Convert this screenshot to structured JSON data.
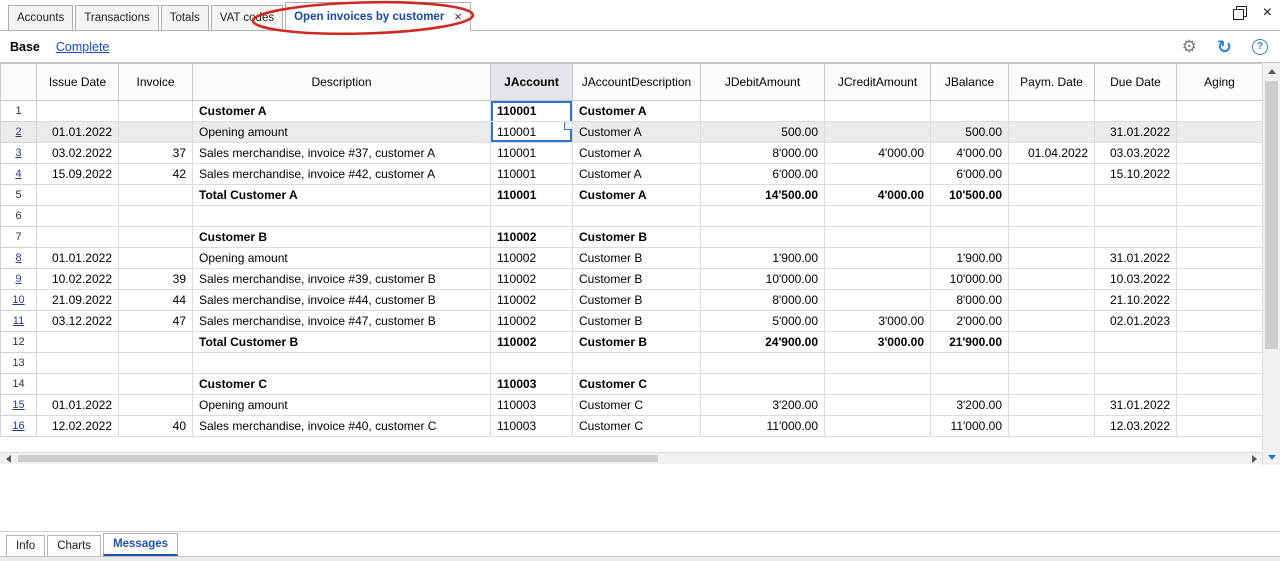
{
  "icons": {
    "close": "×",
    "gear": "⚙",
    "refresh": "↻",
    "help": "?"
  },
  "window": {
    "tabs": [
      {
        "label": "Accounts"
      },
      {
        "label": "Transactions"
      },
      {
        "label": "Totals"
      },
      {
        "label": "VAT codes"
      },
      {
        "label": "Open invoices by customer",
        "active": true
      }
    ]
  },
  "toolbar": {
    "view_label": "Base",
    "complete_link": "Complete"
  },
  "table": {
    "selected_column": "JAccount",
    "columns": [
      "",
      "Issue Date",
      "Invoice",
      "Description",
      "JAccount",
      "JAccountDescription",
      "JDebitAmount",
      "JCreditAmount",
      "JBalance",
      "Paym. Date",
      "Due Date",
      "Aging"
    ],
    "rows": [
      {
        "num": "1",
        "description": "Customer A",
        "jaccount": "110001",
        "jaccount_desc": "Customer A",
        "bold": true,
        "sel": "top"
      },
      {
        "num": "2",
        "issue_date": "01.01.2022",
        "description": "Opening amount",
        "jaccount": "110001",
        "jaccount_desc": "Customer A",
        "debit": "500.00",
        "balance": "500.00",
        "due_date": "31.01.2022",
        "hl": true,
        "link": true,
        "sel": "bottom"
      },
      {
        "num": "3",
        "issue_date": "03.02.2022",
        "invoice": "37",
        "description": "Sales merchandise, invoice #37, customer A",
        "jaccount": "110001",
        "jaccount_desc": "Customer A",
        "debit": "8'000.00",
        "credit": "4'000.00",
        "balance": "4'000.00",
        "paym_date": "01.04.2022",
        "due_date": "03.03.2022",
        "link": true
      },
      {
        "num": "4",
        "issue_date": "15.09.2022",
        "invoice": "42",
        "description": "Sales merchandise, invoice #42, customer A",
        "jaccount": "110001",
        "jaccount_desc": "Customer A",
        "debit": "6'000.00",
        "balance": "6'000.00",
        "due_date": "15.10.2022",
        "link": true
      },
      {
        "num": "5",
        "description": "Total Customer A",
        "jaccount": "110001",
        "jaccount_desc": "Customer A",
        "debit": "14'500.00",
        "credit": "4'000.00",
        "balance": "10'500.00",
        "bold": true
      },
      {
        "num": "6"
      },
      {
        "num": "7",
        "description": "Customer B",
        "jaccount": "110002",
        "jaccount_desc": "Customer B",
        "bold": true
      },
      {
        "num": "8",
        "issue_date": "01.01.2022",
        "description": "Opening amount",
        "jaccount": "110002",
        "jaccount_desc": "Customer B",
        "debit": "1'900.00",
        "balance": "1'900.00",
        "due_date": "31.01.2022",
        "link": true
      },
      {
        "num": "9",
        "issue_date": "10.02.2022",
        "invoice": "39",
        "description": "Sales merchandise, invoice #39, customer B",
        "jaccount": "110002",
        "jaccount_desc": "Customer B",
        "debit": "10'000.00",
        "balance": "10'000.00",
        "due_date": "10.03.2022",
        "link": true
      },
      {
        "num": "10",
        "issue_date": "21.09.2022",
        "invoice": "44",
        "description": "Sales merchandise, invoice #44, customer B",
        "jaccount": "110002",
        "jaccount_desc": "Customer B",
        "debit": "8'000.00",
        "balance": "8'000.00",
        "due_date": "21.10.2022",
        "link": true
      },
      {
        "num": "11",
        "issue_date": "03.12.2022",
        "invoice": "47",
        "description": "Sales merchandise, invoice #47, customer B",
        "jaccount": "110002",
        "jaccount_desc": "Customer B",
        "debit": "5'000.00",
        "credit": "3'000.00",
        "balance": "2'000.00",
        "due_date": "02.01.2023",
        "link": true
      },
      {
        "num": "12",
        "description": "Total Customer B",
        "jaccount": "110002",
        "jaccount_desc": "Customer B",
        "debit": "24'900.00",
        "credit": "3'000.00",
        "balance": "21'900.00",
        "bold": true
      },
      {
        "num": "13"
      },
      {
        "num": "14",
        "description": "Customer C",
        "jaccount": "110003",
        "jaccount_desc": "Customer C",
        "bold": true
      },
      {
        "num": "15",
        "issue_date": "01.01.2022",
        "description": "Opening amount",
        "jaccount": "110003",
        "jaccount_desc": "Customer C",
        "debit": "3'200.00",
        "balance": "3'200.00",
        "due_date": "31.01.2022",
        "link": true
      },
      {
        "num": "16",
        "issue_date": "12.02.2022",
        "invoice": "40",
        "description": "Sales merchandise, invoice #40, customer C",
        "jaccount": "110003",
        "jaccount_desc": "Customer C",
        "debit": "11'000.00",
        "balance": "11'000.00",
        "due_date": "12.03.2022",
        "link": true
      }
    ]
  },
  "bottom_tabs": [
    {
      "label": "Info"
    },
    {
      "label": "Charts"
    },
    {
      "label": "Messages",
      "active": true
    }
  ]
}
